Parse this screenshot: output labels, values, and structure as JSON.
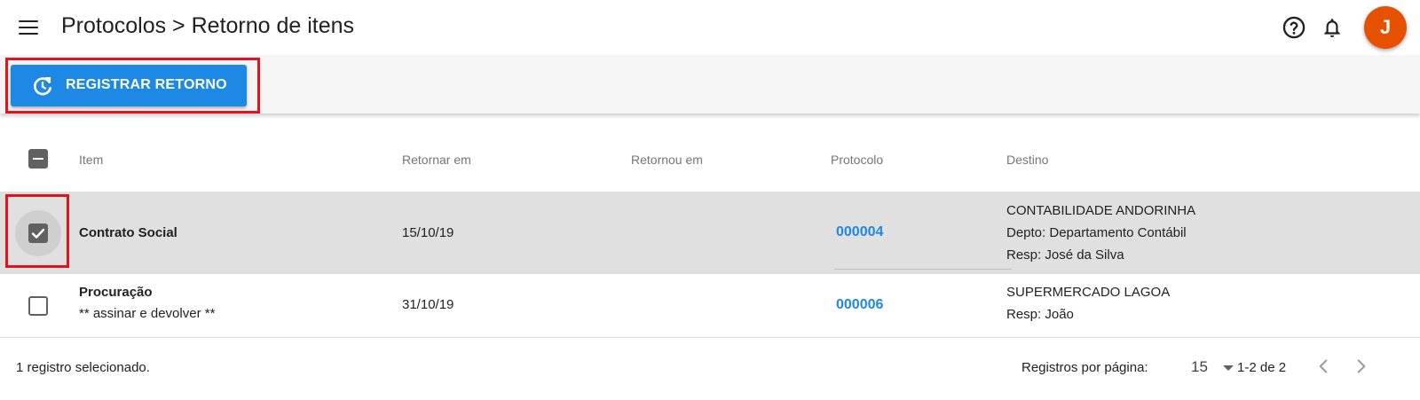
{
  "header": {
    "title": "Protocolos > Retorno de itens",
    "menu_icon": "hamburger-menu-icon",
    "help_icon": "help-circle-icon",
    "bell_icon": "bell-icon",
    "avatar_initial": "J",
    "avatar_color": "#e65100"
  },
  "toolbar": {
    "register_label": "REGISTRAR RETORNO",
    "register_icon": "refresh-icon",
    "accent_color": "#1e88e5"
  },
  "table": {
    "columns": [
      "Item",
      "Retornar em",
      "Retornou em",
      "Protocolo",
      "Destino"
    ],
    "select_all_state": "indeterminate",
    "rows": [
      {
        "selected": true,
        "item": "Contrato Social",
        "item_note": "",
        "return_by": "15/10/19",
        "returned_on": "",
        "protocol": "000004",
        "destination": [
          "CONTABILIDADE ANDORINHA",
          "Depto: Departamento Contábil",
          "Resp: José da Silva"
        ]
      },
      {
        "selected": false,
        "item": "Procuração",
        "item_note": "** assinar e devolver **",
        "return_by": "31/10/19",
        "returned_on": "",
        "protocol": "000006",
        "destination": [
          "SUPERMERCADO LAGOA",
          "Resp: João"
        ]
      }
    ]
  },
  "footer": {
    "selection_status": "1 registro selecionado.",
    "rows_per_page_label": "Registros por página:",
    "rows_per_page_value": "15",
    "page_range": "1-2 de 2",
    "prev_icon": "chevron-left-icon",
    "next_icon": "chevron-right-icon"
  }
}
